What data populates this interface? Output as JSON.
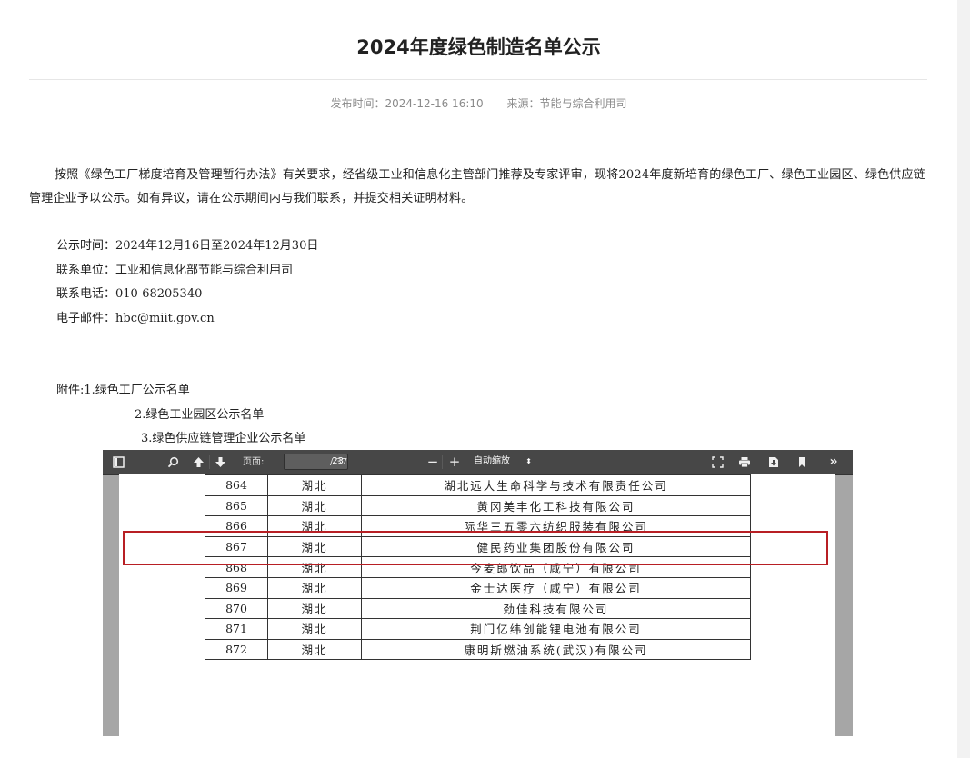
{
  "article": {
    "title": "2024年度绿色制造名单公示",
    "publish_time": "发布时间：2024-12-16 16:10",
    "source": "来源：节能与综合利用司",
    "body": "按照《绿色工厂梯度培育及管理暂行办法》有关要求，经省级工业和信息化主管部门推荐及专家评审，现将2024年度新培育的绿色工厂、绿色工业园区、绿色供应链管理企业予以公示。如有异议，请在公示期间内与我们联系，并提交相关证明材料。",
    "info": [
      "公示时间：2024年12月16日至2024年12月30日",
      "联系单位：工业和信息化部节能与综合利用司",
      "联系电话：010-68205340",
      "电子邮件：hbc@miit.gov.cn"
    ],
    "attachments": [
      "附件:1.绿色工厂公示名单",
      "2.绿色工业园区公示名单",
      "3.绿色供应链管理企业公示名单"
    ]
  },
  "pdf_viewer": {
    "page_label": "页面:",
    "current_page": "23",
    "total_pages": "/ 37",
    "zoom": "自动缩放",
    "icons": [
      "sidebar-toggle-icon",
      "search-icon",
      "prev-page-icon",
      "next-page-icon",
      "zoom-out-icon",
      "zoom-in-icon",
      "fullscreen-icon",
      "print-icon",
      "download-icon",
      "bookmark-icon",
      "more-tools-icon"
    ],
    "rows": [
      {
        "no": "864",
        "province": "湖北",
        "company": "湖北远大生命科学与技术有限责任公司"
      },
      {
        "no": "865",
        "province": "湖北",
        "company": "黄冈美丰化工科技有限公司"
      },
      {
        "no": "866",
        "province": "湖北",
        "company": "际华三五零六纺织服装有限公司"
      },
      {
        "no": "867",
        "province": "湖北",
        "company": "健民药业集团股份有限公司"
      },
      {
        "no": "868",
        "province": "湖北",
        "company": "今麦郎饮品（咸宁）有限公司"
      },
      {
        "no": "869",
        "province": "湖北",
        "company": "金士达医疗（咸宁）有限公司"
      },
      {
        "no": "870",
        "province": "湖北",
        "company": "劲佳科技有限公司"
      },
      {
        "no": "871",
        "province": "湖北",
        "company": "荆门亿纬创能锂电池有限公司"
      },
      {
        "no": "872",
        "province": "湖北",
        "company": "康明斯燃油系统(武汉)有限公司"
      }
    ],
    "highlight_color": "#b81f24"
  }
}
